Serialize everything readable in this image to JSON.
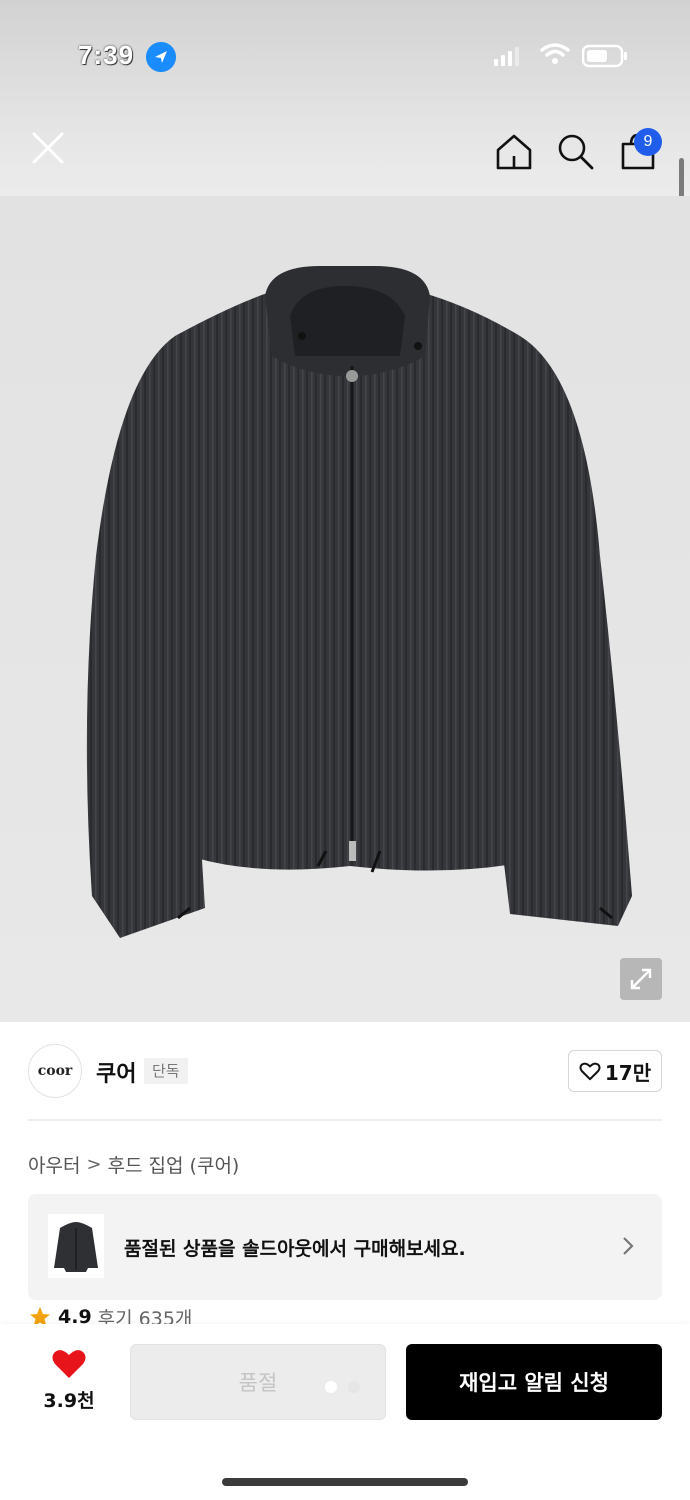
{
  "status_bar": {
    "time": "7:39"
  },
  "header": {
    "cart_count": "9"
  },
  "brand": {
    "logo_text": "coor",
    "name": "쿠어",
    "badge": "단독",
    "likes": "17만"
  },
  "breadcrumb": {
    "category": "아우터",
    "separator": ">",
    "subcategory": "후드 집업 (쿠어)"
  },
  "soldout_banner": {
    "text": "품절된 상품을 솔드아웃에서 구매해보세요."
  },
  "rating": {
    "score": "4.9",
    "reviews": "후기 635개"
  },
  "bottom_bar": {
    "heart_count": "3.9천",
    "soldout_label": "품절",
    "restock_label": "재입고 알림 신청"
  },
  "colors": {
    "accent_blue": "#1f5dea",
    "heart_red": "#e8141b",
    "star_orange": "#f5a30a",
    "button_black": "#000000"
  },
  "icons": [
    "close-icon",
    "home-icon",
    "search-icon",
    "cart-icon",
    "expand-icon",
    "heart-outline-icon",
    "chevron-right-icon",
    "star-icon",
    "heart-filled-icon"
  ]
}
